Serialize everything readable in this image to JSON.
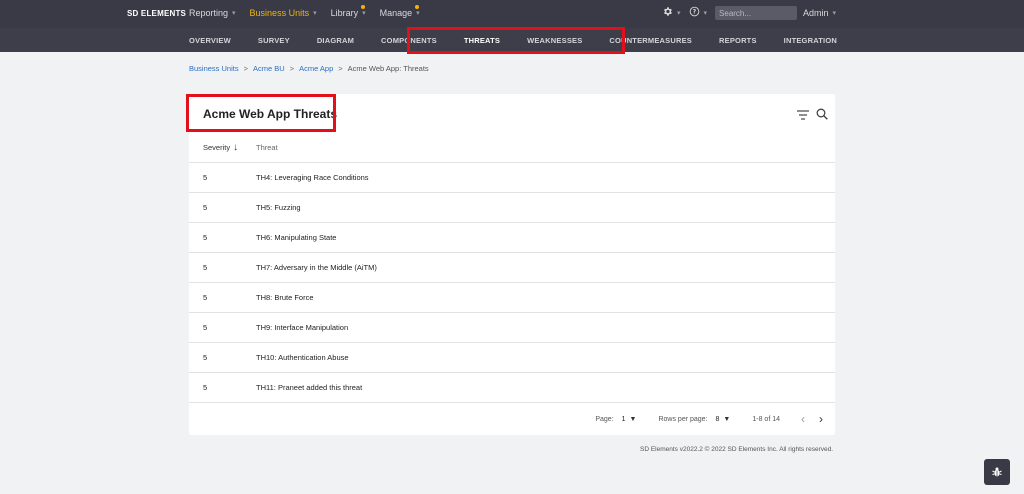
{
  "brand": "SD ELEMENTS",
  "topnav": [
    {
      "label": "Reporting",
      "active": false,
      "dot": false
    },
    {
      "label": "Business Units",
      "active": true,
      "dot": false
    },
    {
      "label": "Library",
      "active": false,
      "dot": true
    },
    {
      "label": "Manage",
      "active": false,
      "dot": true
    }
  ],
  "header": {
    "search_placeholder": "Search...",
    "user": "Admin",
    "icons": [
      "gear-icon",
      "help-icon"
    ]
  },
  "tabs": [
    {
      "label": "OVERVIEW",
      "active": false
    },
    {
      "label": "SURVEY",
      "active": false
    },
    {
      "label": "DIAGRAM",
      "active": false
    },
    {
      "label": "COMPONENTS",
      "active": false
    },
    {
      "label": "THREATS",
      "active": true
    },
    {
      "label": "WEAKNESSES",
      "active": false
    },
    {
      "label": "COUNTERMEASURES",
      "active": false
    },
    {
      "label": "REPORTS",
      "active": false
    },
    {
      "label": "INTEGRATION",
      "active": false
    }
  ],
  "breadcrumb": {
    "links": [
      "Business Units",
      "Acme BU",
      "Acme App"
    ],
    "current": "Acme Web App: Threats",
    "separator": ">"
  },
  "page_title": "Acme Web App Threats",
  "table": {
    "columns": [
      "Severity",
      "Threat"
    ],
    "rows": [
      {
        "severity": "5",
        "threat": "TH4: Leveraging Race Conditions"
      },
      {
        "severity": "5",
        "threat": "TH5: Fuzzing"
      },
      {
        "severity": "5",
        "threat": "TH6: Manipulating State"
      },
      {
        "severity": "5",
        "threat": "TH7: Adversary in the Middle (AiTM)"
      },
      {
        "severity": "5",
        "threat": "TH8: Brute Force"
      },
      {
        "severity": "5",
        "threat": "TH9: Interface Manipulation"
      },
      {
        "severity": "5",
        "threat": "TH10: Authentication Abuse"
      },
      {
        "severity": "5",
        "threat": "TH11: Praneet added this threat"
      }
    ]
  },
  "pagination": {
    "page_label": "Page:",
    "page_value": "1",
    "rows_label": "Rows per page:",
    "rows_value": "8",
    "range": "1-8 of 14"
  },
  "copyright": "SD Elements v2022.2 © 2022 SD Elements Inc. All rights reserved.",
  "colors": {
    "accent": "#f4b400",
    "topbar": "#393a46",
    "highlight": "#e3101b",
    "link": "#2b6fc4"
  }
}
